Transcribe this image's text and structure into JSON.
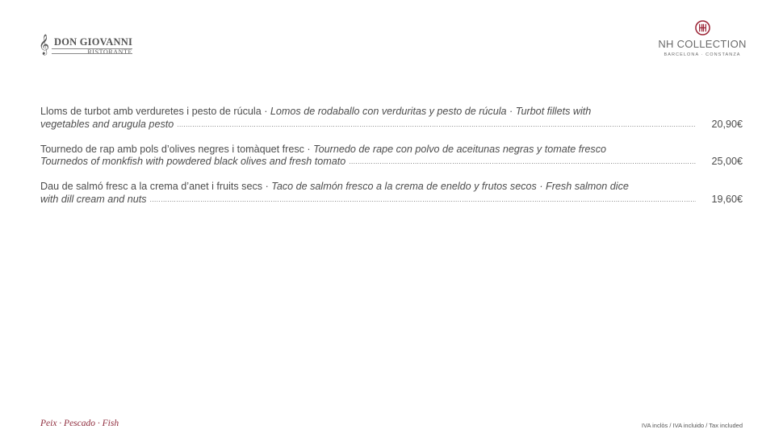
{
  "header": {
    "left_logo": {
      "name": "DON GIOVANNI",
      "subtitle": "RISTORANTE",
      "icon": "treble-clef-icon"
    },
    "right_logo": {
      "name": "NH COLLECTION",
      "subtitle": "BARCELONA · CONSTANZA",
      "icon": "nh-emblem-icon",
      "accent_color": "#9b2335"
    }
  },
  "menu": {
    "items": [
      {
        "name_ca": "Lloms de turbot amb verduretes i pesto de rúcula · ",
        "line1_italic": "Lomos de rodaballo con verduritas y pesto de rúcula · Turbot fillets with",
        "line2_italic": "vegetables and arugula pesto",
        "price": "20,90€"
      },
      {
        "name_ca": "Tournedo de rap amb pols d’olives negres i tomàquet fresc · ",
        "line1_italic": "Tournedo de rape con polvo de aceitunas negras y tomate fresco",
        "line2_italic": "Tournedos of monkfish with powdered black olives and fresh tomato",
        "price": "25,00€"
      },
      {
        "name_ca": "Dau de salmó fresc a la crema d’anet i fruits secs · ",
        "line1_italic": "Taco de salmón fresco a la crema de eneldo y frutos secos · Fresh salmon dice",
        "line2_italic": "with dill cream and nuts",
        "price": "19,60€"
      }
    ]
  },
  "footer": {
    "section": "Peix · Pescado · Fish",
    "section_color": "#8e2a3b",
    "tax_note": "IVA inclòs / IVA incluido / Tax included"
  }
}
